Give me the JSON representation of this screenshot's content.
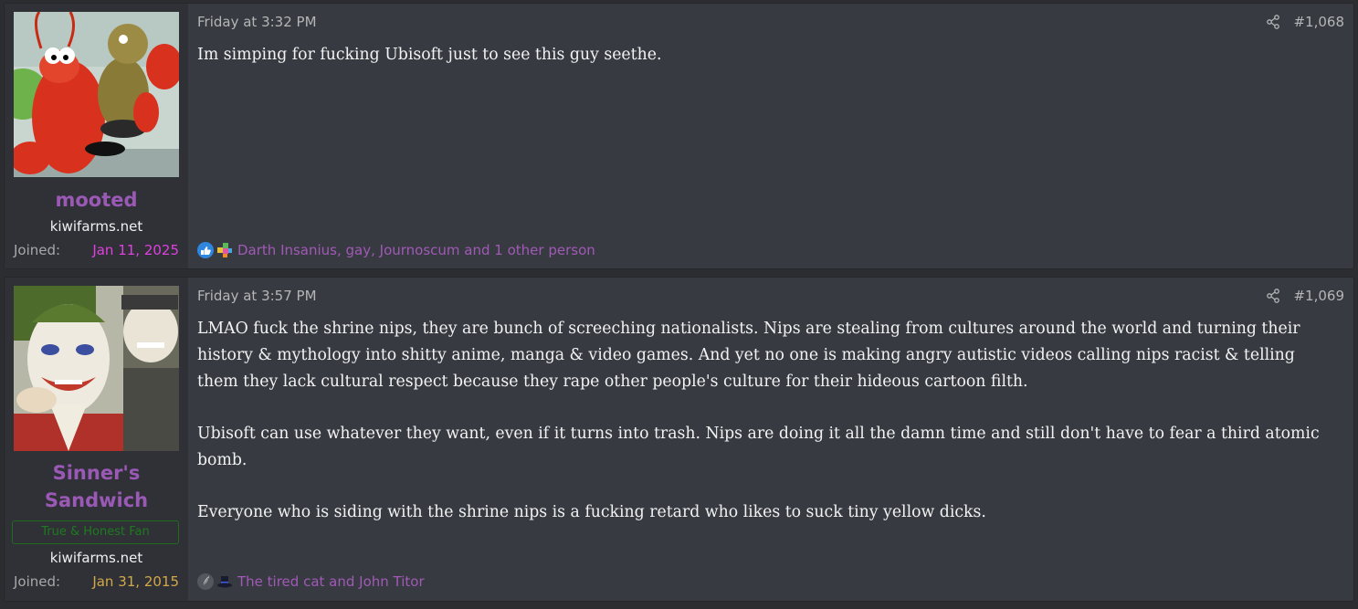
{
  "posts": [
    {
      "username": "mooted",
      "user_title": "",
      "site": "kiwifarms.net",
      "joined_label": "Joined:",
      "joined_date": "Jan 11, 2025",
      "date": "Friday at 3:32 PM",
      "post_number": "#1,068",
      "body": [
        "Im simping for fucking Ubisoft just to see this guy seethe."
      ],
      "reactions_text": "Darth Insanius, gay, Journoscum and 1 other person",
      "reaction_icons": [
        "like-icon",
        "puzzle-icon"
      ]
    },
    {
      "username_lines": [
        "Sinner's",
        "Sandwich"
      ],
      "user_title": "True & Honest Fan",
      "site": "kiwifarms.net",
      "joined_label": "Joined:",
      "joined_date": "Jan 31, 2015",
      "date": "Friday at 3:57 PM",
      "post_number": "#1,069",
      "body": [
        "LMAO fuck the shrine nips, they are bunch of screeching nationalists. Nips are stealing from cultures around the world and turning their history & mythology into shitty anime, manga & video games. And yet no one is making angry autistic videos calling nips racist & telling them they lack cultural respect because they rape other people's culture for their hideous cartoon filth.",
        "Ubisoft can use whatever they want, even if it turns into trash. Nips are doing it all the damn time and still don't have to fear a third atomic bomb.",
        "Everyone who is siding with the shrine nips is a fucking retard who likes to suck tiny yellow dicks."
      ],
      "reactions_text": "The tired cat and John Titor",
      "reaction_icons": [
        "feather-icon",
        "top-hat-icon"
      ]
    }
  ],
  "colors": {
    "username": "#9b59b6",
    "reaction_link": "#a05ab5",
    "joined_date_1": "#e040e0",
    "joined_date_2": "#d4a848",
    "title_badge": "#1f7a1f"
  }
}
